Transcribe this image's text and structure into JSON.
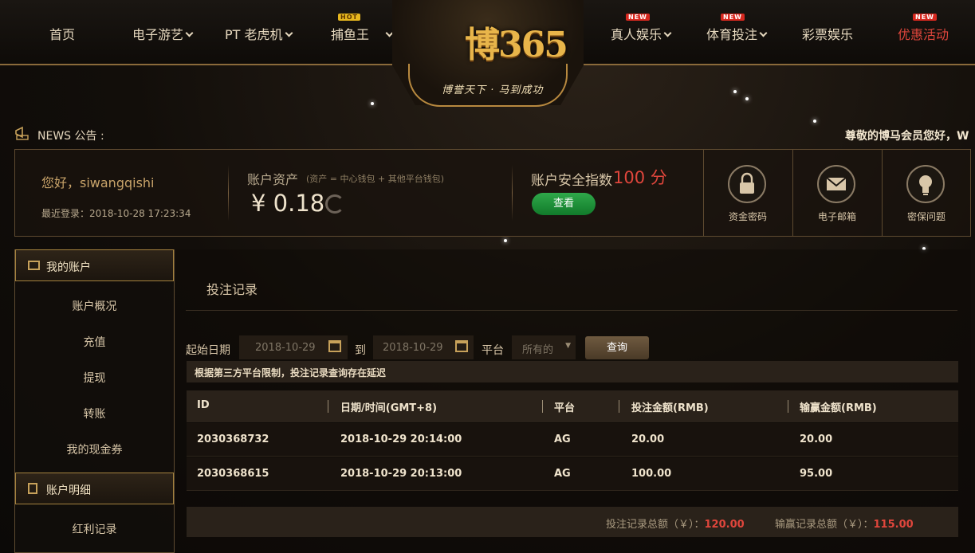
{
  "nav": {
    "home": "首页",
    "electronic": "电子游艺",
    "pt_slots": "PT 老虎机",
    "fishing": "捕鱼王",
    "fishing_tag": "HOT",
    "live": "真人娱乐",
    "live_tag": "NEW",
    "sports": "体育投注",
    "sports_tag": "NEW",
    "lottery": "彩票娱乐",
    "promo": "优惠活动",
    "promo_tag": "NEW"
  },
  "logo": {
    "title": "博365",
    "slogan": "博誉天下 · 马到成功"
  },
  "news": {
    "label": "NEWS 公告 :",
    "text": "尊敬的博马会员您好，W"
  },
  "account": {
    "greeting": "您好，siwangqishi",
    "last_login": "最近登录：2018-10-28 17:23:34",
    "asset_title": "账户资产",
    "asset_note": "(资产 = 中心钱包 + 其他平台钱包)",
    "asset_value": "¥ 0.18",
    "security_title": "账户安全指数",
    "security_score": "100 分",
    "view_button": "查看",
    "tiles": [
      "资金密码",
      "电子邮箱",
      "密保问题"
    ]
  },
  "sidebar": {
    "my_account": "我的账户",
    "links_a": [
      "账户概况",
      "充值",
      "提现",
      "转账",
      "我的现金券"
    ],
    "details": "账户明细",
    "links_b": [
      "红利记录"
    ]
  },
  "main": {
    "title": "投注记录",
    "start_label": "起始日期",
    "start_date": "2018-10-29",
    "to_label": "到",
    "end_date": "2018-10-29",
    "platform_label": "平台",
    "platform_value": "所有的",
    "query_button": "查询",
    "notice": "根据第三方平台限制，投注记录查询存在延迟"
  },
  "table": {
    "headers": [
      "ID",
      "日期/时间(GMT+8)",
      "平台",
      "投注金额(RMB)",
      "输赢金额(RMB)"
    ],
    "rows": [
      [
        "2030368732",
        "2018-10-29 20:14:00",
        "AG",
        "20.00",
        "20.00"
      ],
      [
        "2030368615",
        "2018-10-29 20:13:00",
        "AG",
        "100.00",
        "95.00"
      ]
    ],
    "footer": {
      "bet_total_label": "投注记录总额（￥）：",
      "bet_total": "120.00",
      "win_total_label": "输赢记录总额（￥）：",
      "win_total": "115.00"
    }
  },
  "colors": {
    "accent_red": "#e0463c",
    "gold": "#c7a15a",
    "green_button": "#2fa84a"
  }
}
